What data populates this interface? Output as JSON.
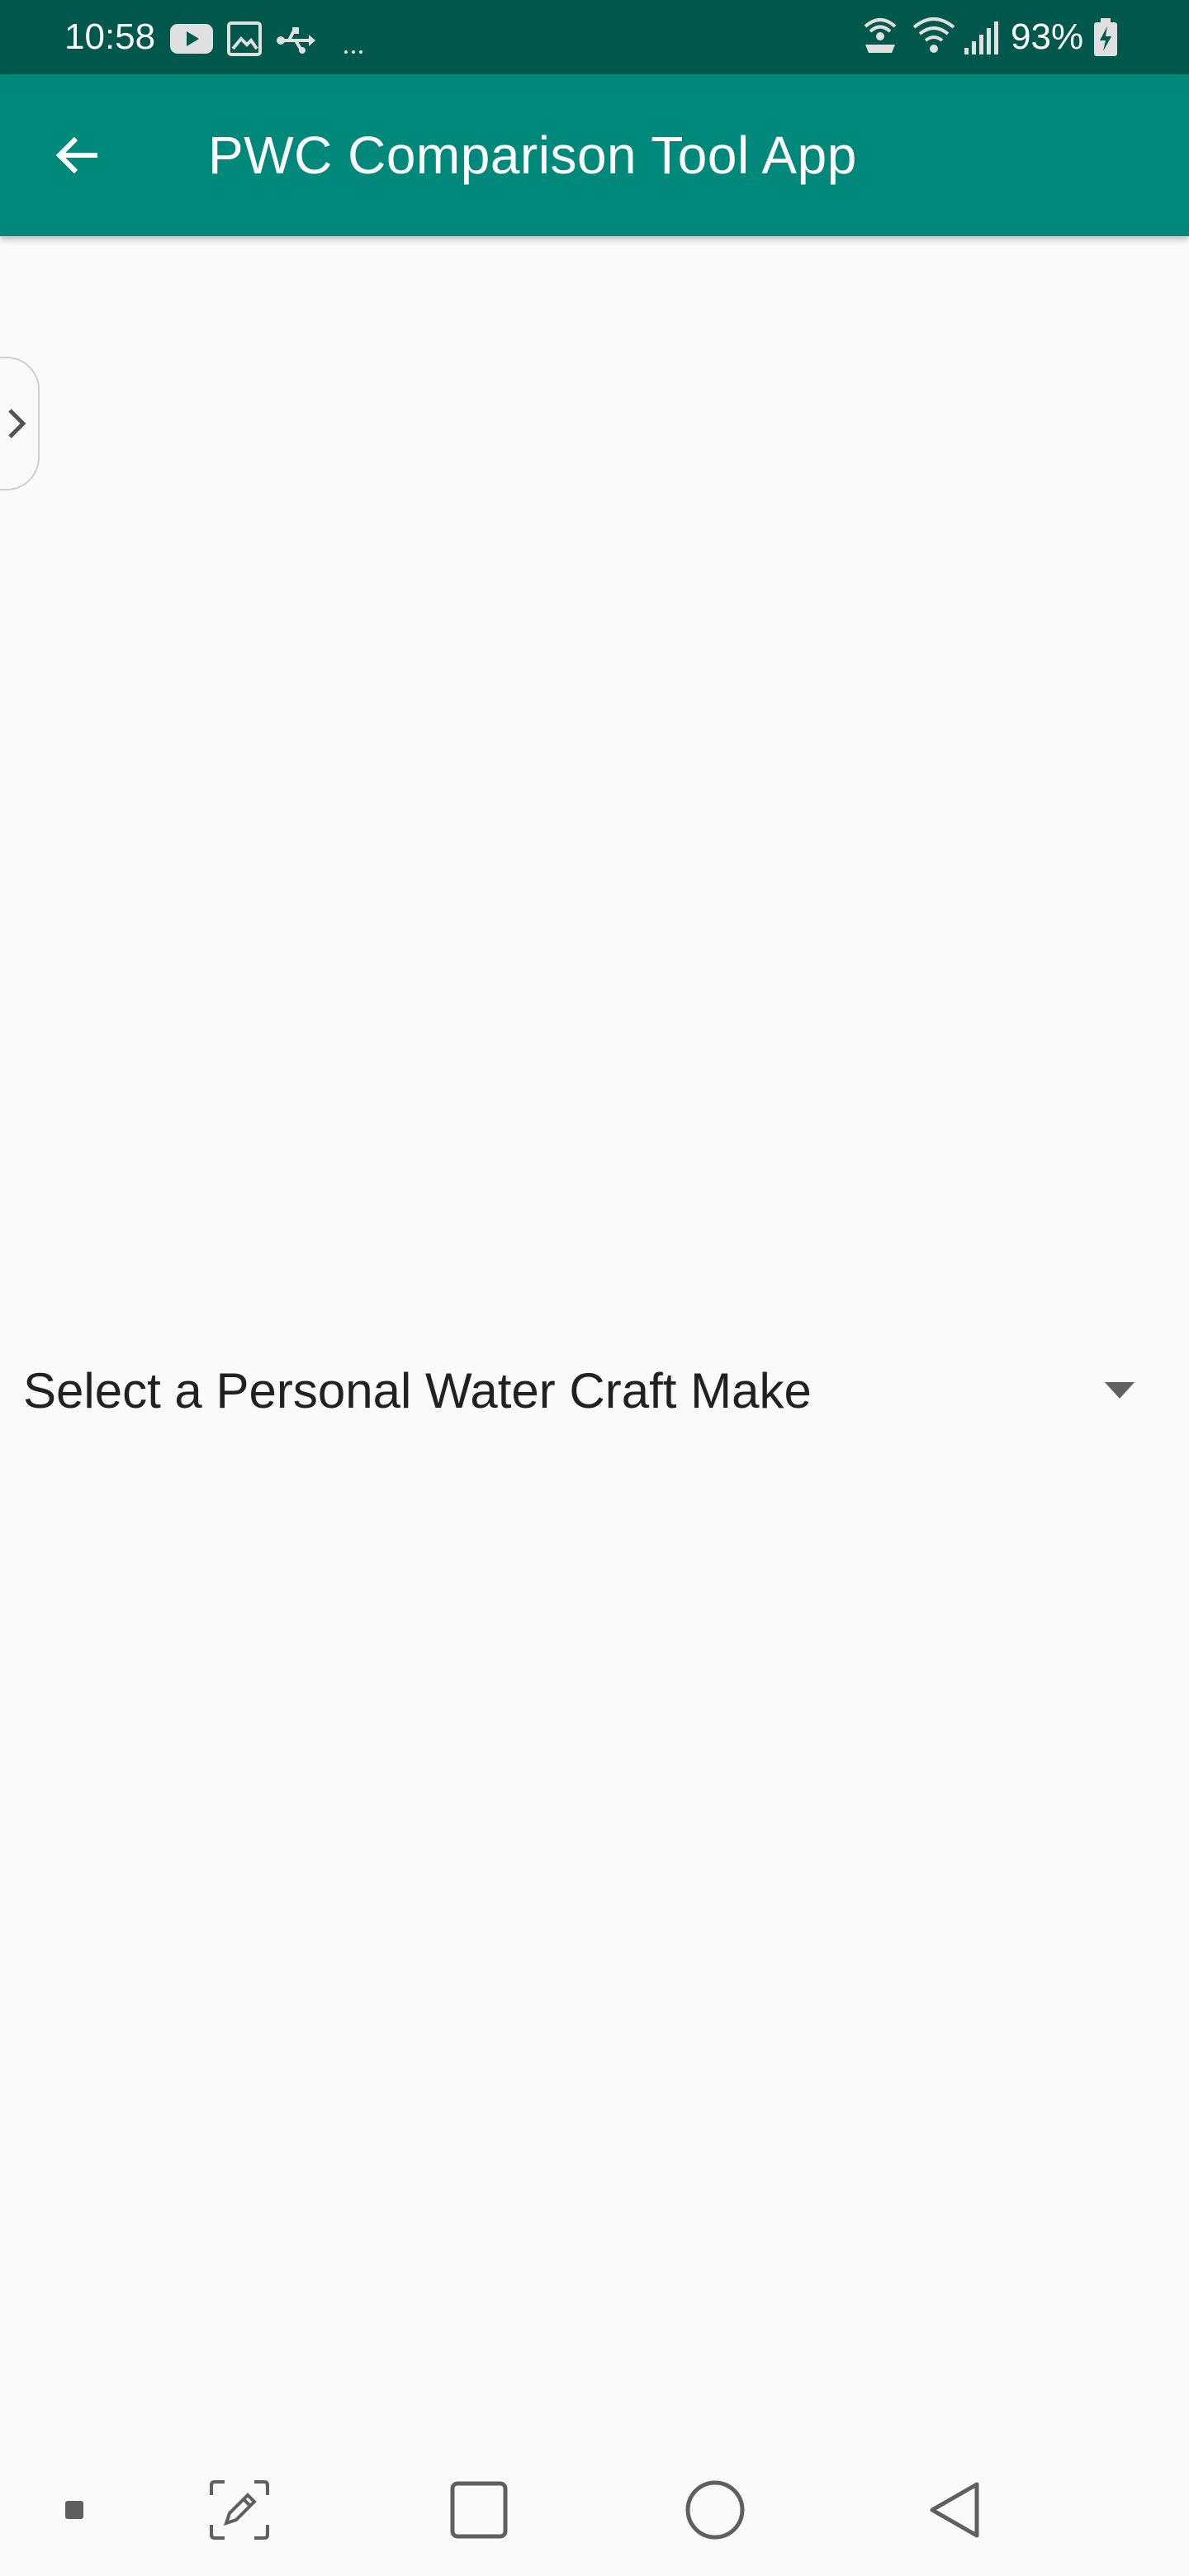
{
  "status_bar": {
    "time": "10:58",
    "battery": "93%",
    "icons": [
      "youtube-icon",
      "image-icon",
      "usb-icon",
      "more-dots-icon",
      "hotspot-icon",
      "wifi-icon",
      "signal-icon",
      "battery-charging-icon"
    ]
  },
  "app_bar": {
    "title": "PWC Comparison Tool App",
    "back_icon": "arrow-back-icon",
    "color": "#00897b",
    "status_color": "#00574b"
  },
  "drawer": {
    "icon": "chevron-right-icon"
  },
  "spinner": {
    "selected_value": "Select a Personal Water Craft Make",
    "icon": "dropdown-arrow-icon"
  },
  "nav_bar": {
    "buttons": [
      "dot-button",
      "screenshot-edit-button",
      "recents-button",
      "home-button",
      "back-button"
    ]
  }
}
